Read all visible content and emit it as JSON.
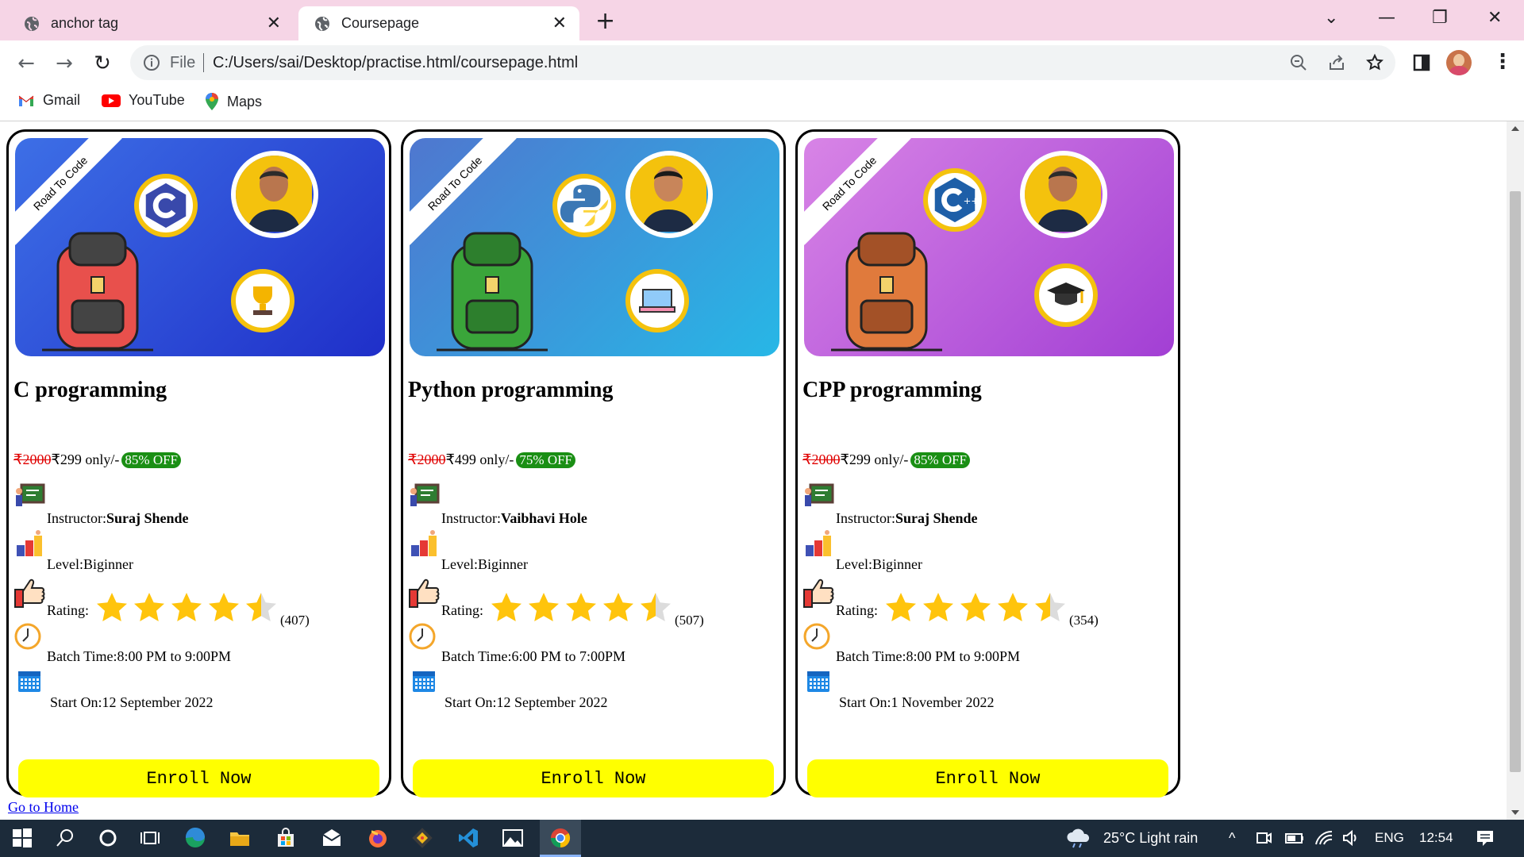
{
  "browser": {
    "tabs": [
      {
        "title": "anchor tag",
        "active": false
      },
      {
        "title": "Coursepage",
        "active": true
      }
    ],
    "address": {
      "scheme": "File",
      "url": "C:/Users/sai/Desktop/practise.html/coursepage.html"
    },
    "bookmarks": [
      "Gmail",
      "YouTube",
      "Maps"
    ]
  },
  "page": {
    "ribbon_text": "Road To Code",
    "courses": [
      {
        "title": "C programming",
        "old_price": "₹2000",
        "price": "₹299 only/-",
        "discount": "85% OFF",
        "instructor_label": "Instructor:",
        "instructor": "Suraj Shende",
        "level": "Level:Biginner",
        "rating_label": "Rating:",
        "rating": 4.5,
        "reviews": "(407)",
        "batch_time": "Batch Time:8:00 PM to 9:00PM",
        "start": "Start On:12 September 2022",
        "button": "Enroll Now",
        "banner_color": "#3d6fe6",
        "banner_color2": "#1f2fc9"
      },
      {
        "title": "Python programming",
        "old_price": "₹2000",
        "price": "₹499 only/-",
        "discount": "75% OFF",
        "instructor_label": "Instructor:",
        "instructor": "Vaibhavi Hole",
        "level": "Level:Biginner",
        "rating_label": "Rating:",
        "rating": 4.5,
        "reviews": "(507)",
        "batch_time": "Batch Time:6:00 PM to 7:00PM",
        "start": "Start On:12 September 2022",
        "button": "Enroll Now",
        "banner_color": "#4f77cf",
        "banner_color2": "#27b7e6"
      },
      {
        "title": "CPP programming",
        "old_price": "₹2000",
        "price": "₹299 only/-",
        "discount": "85% OFF",
        "instructor_label": "Instructor:",
        "instructor": "Suraj Shende",
        "level": "Level:Biginner",
        "rating_label": "Rating:",
        "rating": 4.5,
        "reviews": "(354)",
        "batch_time": "Batch Time:8:00 PM to 9:00PM",
        "start": "Start On:1 November 2022",
        "button": "Enroll Now",
        "banner_color": "#d884e6",
        "banner_color2": "#a23fd4"
      }
    ],
    "home_link": "Go to Home"
  },
  "taskbar": {
    "weather": "25°C  Light rain",
    "language": "ENG",
    "time": "12:54"
  }
}
